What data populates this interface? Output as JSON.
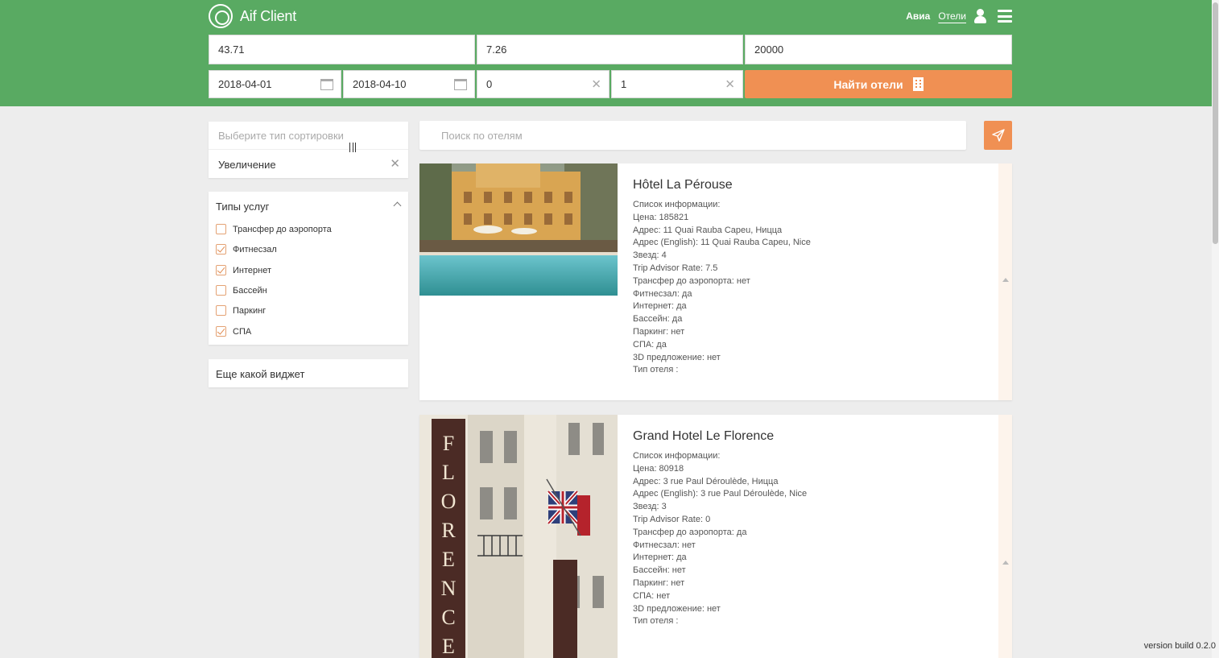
{
  "app": {
    "name": "Aif Client",
    "nav": {
      "avia": "Авиа",
      "hotels": "Отели"
    }
  },
  "search_form": {
    "latitude": "43.71",
    "longitude": "7.26",
    "radius": "20000",
    "date_from": "2018-04-01",
    "date_to": "2018-04-10",
    "children": "0",
    "adults": "1",
    "find_button": "Найти отели"
  },
  "sort": {
    "placeholder": "Выберите тип сортировки",
    "value": "Увеличение"
  },
  "services": {
    "title": "Типы услуг",
    "items": [
      {
        "label": "Трансфер до аэропорта",
        "checked": false
      },
      {
        "label": "Фитнесзал",
        "checked": true
      },
      {
        "label": "Интернет",
        "checked": true
      },
      {
        "label": "Бассейн",
        "checked": false
      },
      {
        "label": "Паркинг",
        "checked": false
      },
      {
        "label": "СПА",
        "checked": true
      }
    ]
  },
  "widget": {
    "title": "Еще какой виджет"
  },
  "hotel_search": {
    "placeholder": "Поиск по отелям"
  },
  "hotels": [
    {
      "name": "Hôtel La Pérouse",
      "info": [
        "Список информации:",
        "Цена: 185821",
        "Адрес: 11 Quai Rauba Capeu, Ницца",
        "Адрес (English): 11 Quai Rauba Capeu, Nice",
        "Звезд: 4",
        "Trip Advisor Rate: 7.5",
        "Трансфер до аэропорта: нет",
        "Фитнесзал: да",
        "Интернет: да",
        "Бассейн: да",
        "Паркинг: нет",
        "СПА: да",
        "3D предложение: нет",
        "Тип отеля :"
      ]
    },
    {
      "name": "Grand Hotel Le Florence",
      "info": [
        "Список информации:",
        "Цена: 80918",
        "Адрес: 3 rue Paul Déroulède, Ницца",
        "Адрес (English): 3 rue Paul Déroulède, Nice",
        "Звезд: 3",
        "Trip Advisor Rate: 0",
        "Трансфер до аэропорта: да",
        "Фитнесзал: нет",
        "Интернет: да",
        "Бассейн: нет",
        "Паркинг: нет",
        "СПА: нет",
        "3D предложение: нет",
        "Тип отеля :"
      ],
      "image_text": "FLORENCE"
    }
  ],
  "footer": {
    "version": "version build 0.2.0"
  },
  "colors": {
    "header": "#59aa62",
    "accent": "#f09053",
    "background": "#ededed"
  }
}
